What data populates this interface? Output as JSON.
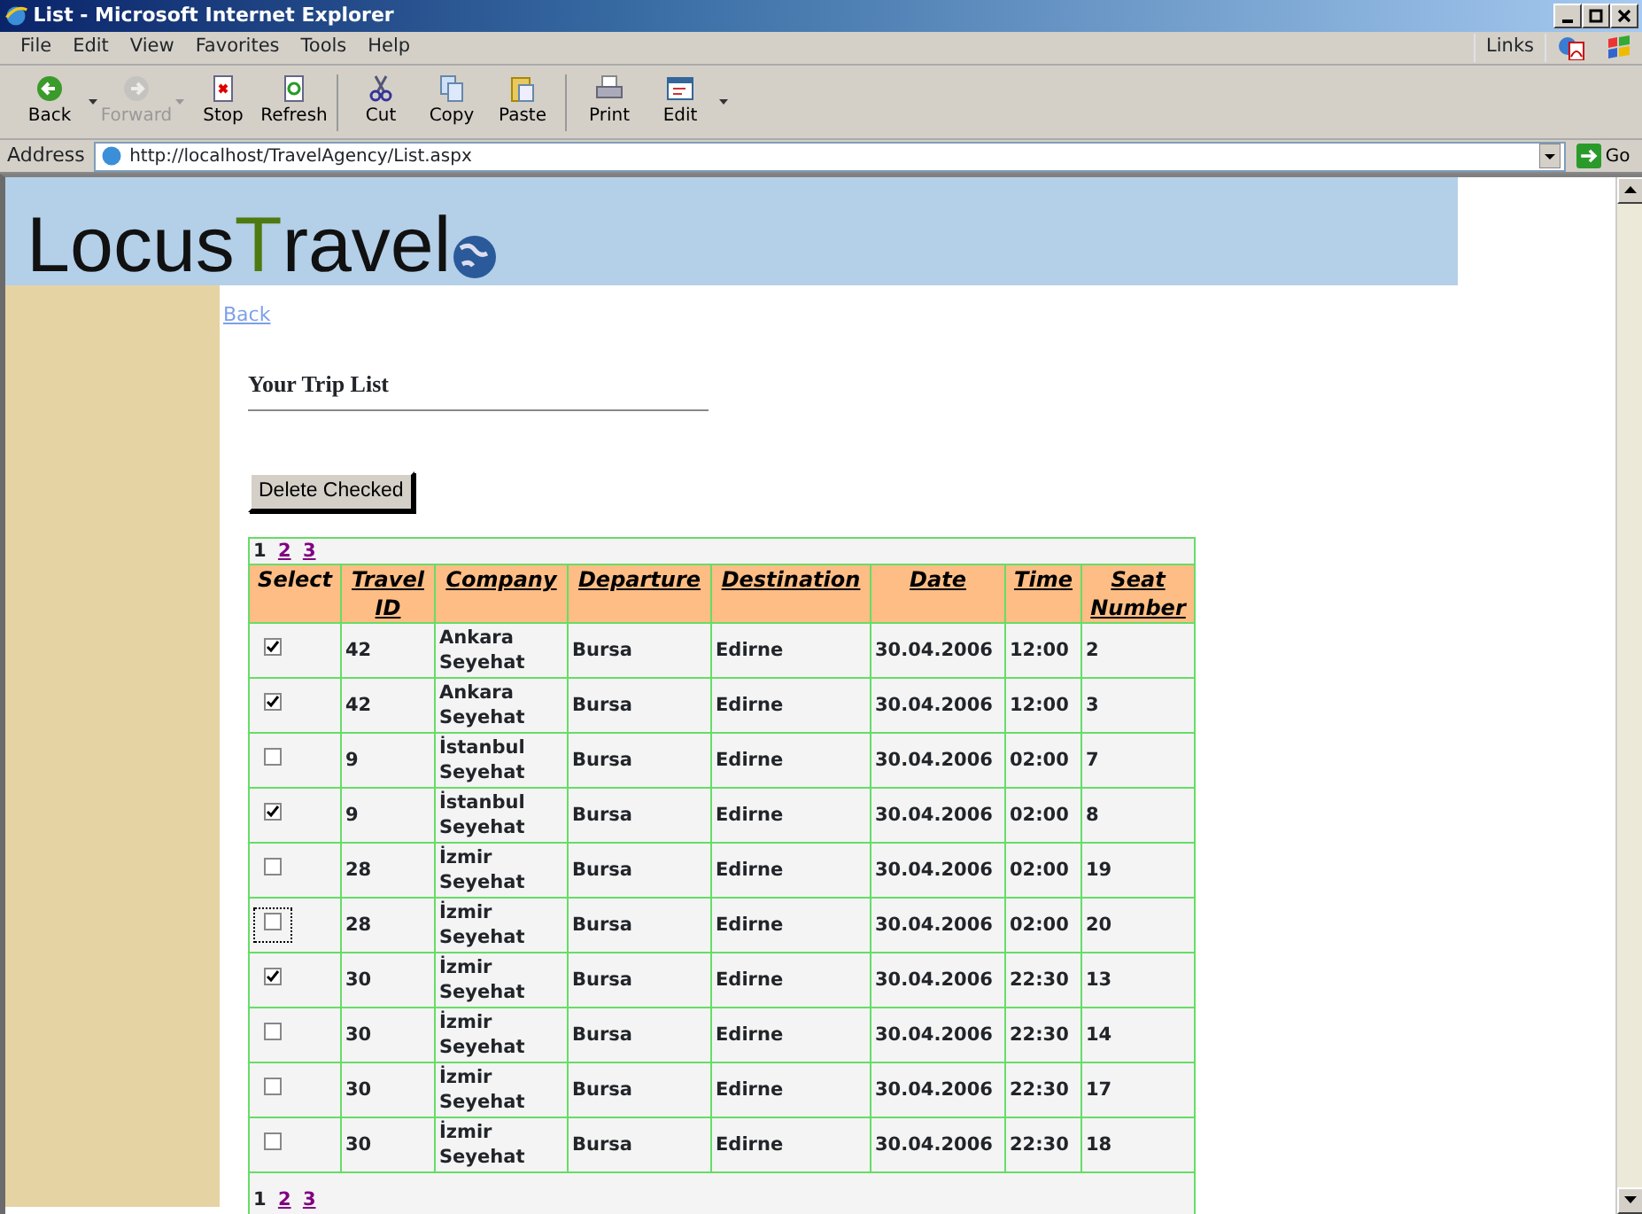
{
  "window": {
    "title": "List - Microsoft Internet Explorer"
  },
  "menu": [
    "File",
    "Edit",
    "View",
    "Favorites",
    "Tools",
    "Help"
  ],
  "links_label": "Links",
  "toolbar": [
    {
      "label": "Back",
      "kind": "back",
      "disabled": false,
      "dropdown": true
    },
    {
      "label": "Forward",
      "kind": "forward",
      "disabled": true,
      "dropdown": true
    },
    {
      "label": "Stop",
      "kind": "stop",
      "disabled": false,
      "dropdown": false
    },
    {
      "label": "Refresh",
      "kind": "refresh",
      "disabled": false,
      "dropdown": false
    },
    {
      "label": "Cut",
      "kind": "cut",
      "disabled": false,
      "dropdown": false
    },
    {
      "label": "Copy",
      "kind": "copy",
      "disabled": false,
      "dropdown": false
    },
    {
      "label": "Paste",
      "kind": "paste",
      "disabled": false,
      "dropdown": false
    },
    {
      "label": "Print",
      "kind": "print",
      "disabled": false,
      "dropdown": false
    },
    {
      "label": "Edit",
      "kind": "edit",
      "disabled": false,
      "dropdown": true
    }
  ],
  "address": {
    "label": "Address",
    "value": "http://localhost/TravelAgency/List.aspx",
    "go": "Go"
  },
  "page": {
    "logo": [
      "Locus",
      "T",
      "ravel"
    ],
    "back_link": "Back",
    "heading": "Your Trip List",
    "delete_button": "Delete Checked",
    "pager_top": [
      {
        "label": "1",
        "selected": true
      },
      {
        "label": "2",
        "selected": false
      },
      {
        "label": "3",
        "selected": false
      }
    ],
    "columns": [
      {
        "label": "Select",
        "link": false
      },
      {
        "label": "Travel ID",
        "link": true
      },
      {
        "label": "Company",
        "link": true
      },
      {
        "label": "Departure",
        "link": true
      },
      {
        "label": "Destination",
        "link": true
      },
      {
        "label": "Date",
        "link": true
      },
      {
        "label": "Time",
        "link": true
      },
      {
        "label": "Seat Number",
        "link": true
      }
    ],
    "rows": [
      {
        "checked": true,
        "focused": false,
        "travel_id": "42",
        "company": "Ankara Seyehat",
        "departure": "Bursa",
        "destination": "Edirne",
        "date": "30.04.2006",
        "time": "12:00",
        "seat_number": "2"
      },
      {
        "checked": true,
        "focused": false,
        "travel_id": "42",
        "company": "Ankara Seyehat",
        "departure": "Bursa",
        "destination": "Edirne",
        "date": "30.04.2006",
        "time": "12:00",
        "seat_number": "3"
      },
      {
        "checked": false,
        "focused": false,
        "travel_id": "9",
        "company": "İstanbul Seyehat",
        "departure": "Bursa",
        "destination": "Edirne",
        "date": "30.04.2006",
        "time": "02:00",
        "seat_number": "7"
      },
      {
        "checked": true,
        "focused": false,
        "travel_id": "9",
        "company": "İstanbul Seyehat",
        "departure": "Bursa",
        "destination": "Edirne",
        "date": "30.04.2006",
        "time": "02:00",
        "seat_number": "8"
      },
      {
        "checked": false,
        "focused": false,
        "travel_id": "28",
        "company": "İzmir Seyehat",
        "departure": "Bursa",
        "destination": "Edirne",
        "date": "30.04.2006",
        "time": "02:00",
        "seat_number": "19"
      },
      {
        "checked": false,
        "focused": true,
        "travel_id": "28",
        "company": "İzmir Seyehat",
        "departure": "Bursa",
        "destination": "Edirne",
        "date": "30.04.2006",
        "time": "02:00",
        "seat_number": "20"
      },
      {
        "checked": true,
        "focused": false,
        "travel_id": "30",
        "company": "İzmir Seyehat",
        "departure": "Bursa",
        "destination": "Edirne",
        "date": "30.04.2006",
        "time": "22:30",
        "seat_number": "13"
      },
      {
        "checked": false,
        "focused": false,
        "travel_id": "30",
        "company": "İzmir Seyehat",
        "departure": "Bursa",
        "destination": "Edirne",
        "date": "30.04.2006",
        "time": "22:30",
        "seat_number": "14"
      },
      {
        "checked": false,
        "focused": false,
        "travel_id": "30",
        "company": "İzmir Seyehat",
        "departure": "Bursa",
        "destination": "Edirne",
        "date": "30.04.2006",
        "time": "22:30",
        "seat_number": "17"
      },
      {
        "checked": false,
        "focused": false,
        "travel_id": "30",
        "company": "İzmir Seyehat",
        "departure": "Bursa",
        "destination": "Edirne",
        "date": "30.04.2006",
        "time": "22:30",
        "seat_number": "18"
      }
    ],
    "pager_bottom": [
      {
        "label": "1",
        "selected": true
      },
      {
        "label": "2",
        "selected": false
      },
      {
        "label": "3",
        "selected": false
      }
    ]
  }
}
